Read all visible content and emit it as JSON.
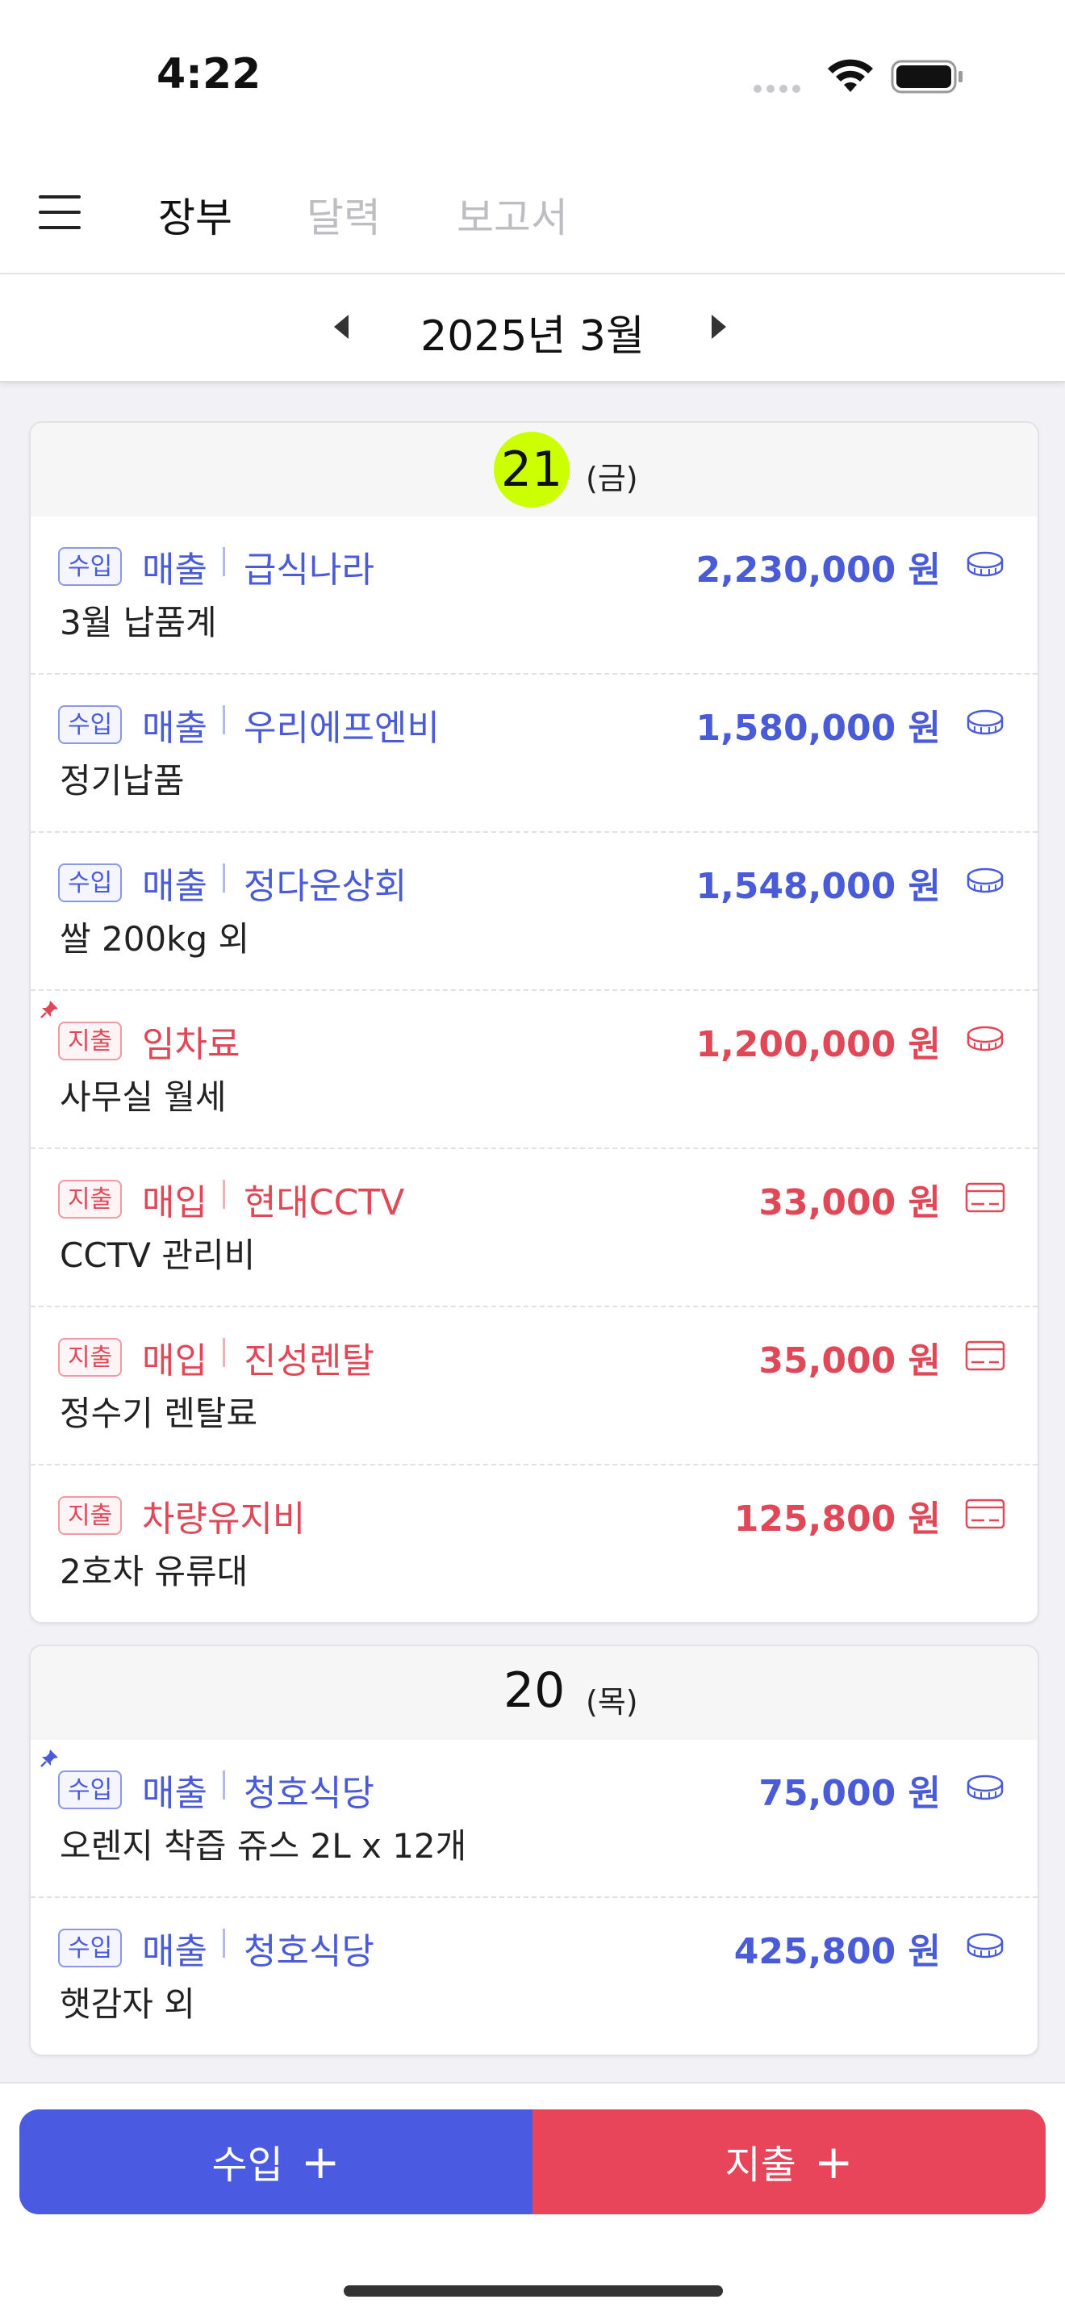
{
  "status_bar": {
    "time": "4:22"
  },
  "nav": {
    "tabs": [
      {
        "label": "장부",
        "active": true
      },
      {
        "label": "달력",
        "active": false
      },
      {
        "label": "보고서",
        "active": false
      }
    ]
  },
  "month": {
    "label": "2025년 3월"
  },
  "colors": {
    "income": "#4a5bd8",
    "expense": "#e04858",
    "today_highlight": "#ccff00"
  },
  "days": [
    {
      "day": "21",
      "weekday": "(금)",
      "today": true,
      "transactions": [
        {
          "type": "수입",
          "category": "매출",
          "vendor": "급식나라",
          "description": "3월 납품계",
          "amount": "2,230,000 원",
          "payment": "cash-icon",
          "pinned": false
        },
        {
          "type": "수입",
          "category": "매출",
          "vendor": "우리에프엔비",
          "description": "정기납품",
          "amount": "1,580,000 원",
          "payment": "cash-icon",
          "pinned": false
        },
        {
          "type": "수입",
          "category": "매출",
          "vendor": "정다운상회",
          "description": "쌀 200kg 외",
          "amount": "1,548,000 원",
          "payment": "cash-icon",
          "pinned": false
        },
        {
          "type": "지출",
          "category": "임차료",
          "vendor": "",
          "description": "사무실 월세",
          "amount": "1,200,000 원",
          "payment": "cash-icon",
          "pinned": true
        },
        {
          "type": "지출",
          "category": "매입",
          "vendor": "현대CCTV",
          "description": "CCTV 관리비",
          "amount": "33,000 원",
          "payment": "card-icon",
          "pinned": false
        },
        {
          "type": "지출",
          "category": "매입",
          "vendor": "진성렌탈",
          "description": "정수기 렌탈료",
          "amount": "35,000 원",
          "payment": "card-icon",
          "pinned": false
        },
        {
          "type": "지출",
          "category": "차량유지비",
          "vendor": "",
          "description": "2호차 유류대",
          "amount": "125,800 원",
          "payment": "card-icon",
          "pinned": false
        }
      ]
    },
    {
      "day": "20",
      "weekday": "(목)",
      "today": false,
      "transactions": [
        {
          "type": "수입",
          "category": "매출",
          "vendor": "청호식당",
          "description": "오렌지 착즙 쥬스 2L x 12개",
          "amount": "75,000 원",
          "payment": "cash-icon",
          "pinned": true
        },
        {
          "type": "수입",
          "category": "매출",
          "vendor": "청호식당",
          "description": "햇감자 외",
          "amount": "425,800 원",
          "payment": "cash-icon",
          "pinned": false
        }
      ]
    }
  ],
  "actions": {
    "income_label": "수입",
    "expense_label": "지출",
    "plus": "+"
  }
}
